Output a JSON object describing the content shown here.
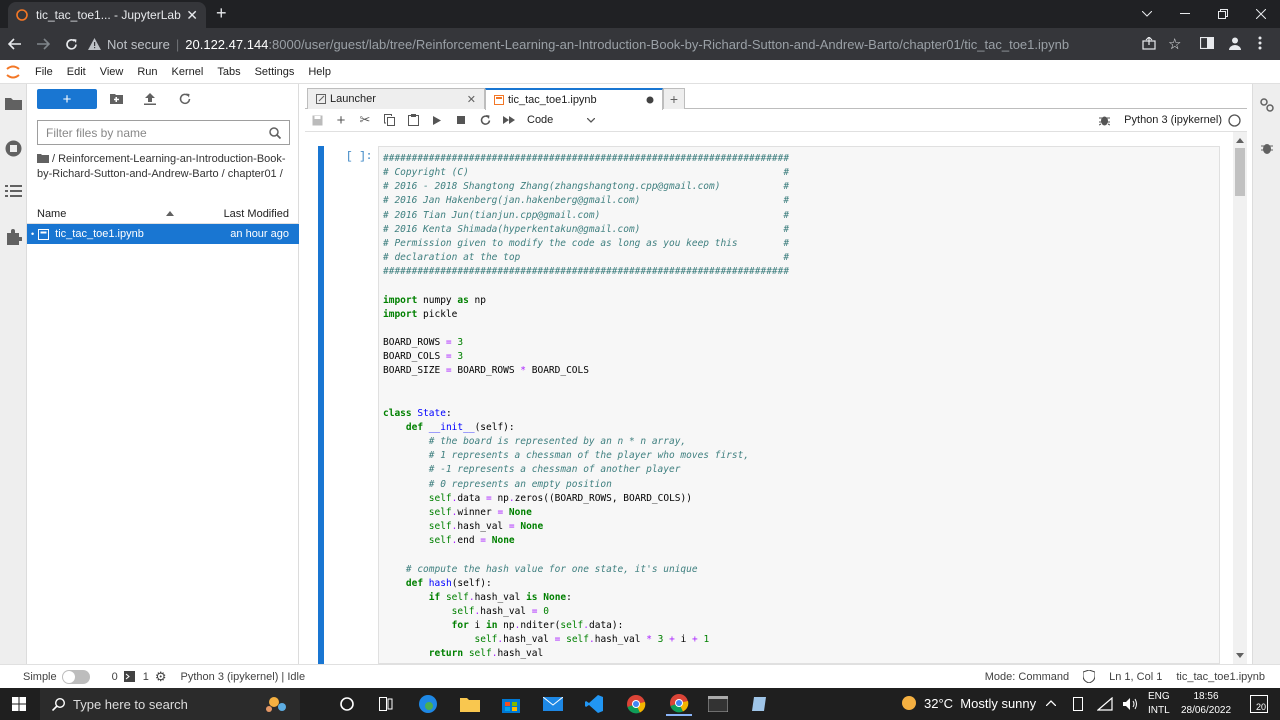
{
  "browser": {
    "tab_title": "tic_tac_toe1... - JupyterLab",
    "security_label": "Not secure",
    "url_host": "20.122.47.144",
    "url_path": ":8000/user/guest/lab/tree/Reinforcement-Learning-an-Introduction-Book-by-Richard-Sutton-and-Andrew-Barto/chapter01/tic_tac_toe1.ipynb"
  },
  "menubar": [
    "File",
    "Edit",
    "View",
    "Run",
    "Kernel",
    "Tabs",
    "Settings",
    "Help"
  ],
  "filebrowser": {
    "new_label": "+",
    "filter_placeholder": "Filter files by name",
    "breadcrumb": "/ Reinforcement-Learning-an-Introduction-Book-by-Richard-Sutton-and-Andrew-Barto / chapter01 /",
    "col_name": "Name",
    "col_modified": "Last Modified",
    "files": [
      {
        "name": "tic_tac_toe1.ipynb",
        "modified": "an hour ago"
      }
    ]
  },
  "doc_tabs": [
    {
      "label": "Launcher"
    },
    {
      "label": "tic_tac_toe1.ipynb"
    }
  ],
  "toolbar": {
    "cell_type": "Code",
    "kernel": "Python 3 (ipykernel)"
  },
  "cell": {
    "prompt": "[ ]:"
  },
  "statusbar": {
    "mode_label": "Simple",
    "count_a": "0",
    "count_b": "1",
    "kernel_status": "Python 3 (ipykernel) | Idle",
    "mode": "Mode: Command",
    "position": "Ln 1, Col 1",
    "filename": "tic_tac_toe1.ipynb"
  },
  "taskbar": {
    "search_placeholder": "Type here to search",
    "weather": "32°C  Mostly sunny",
    "lang1": "ENG",
    "lang2": "INTL",
    "time": "18:56",
    "date": "28/06/2022",
    "notifications": "20"
  },
  "colors": {
    "accent": "#1976d2",
    "comment": "#408080",
    "keyword": "#008000",
    "operator": "#aa22ff"
  }
}
